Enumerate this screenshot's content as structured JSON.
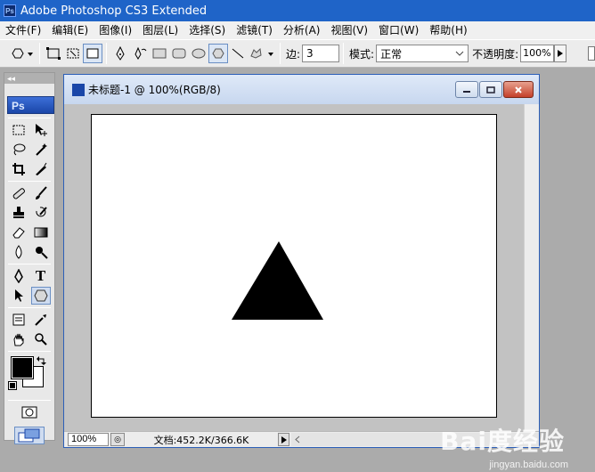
{
  "app": {
    "title": "Adobe Photoshop CS3 Extended",
    "icon_text": "Ps"
  },
  "menubar": {
    "items": [
      {
        "label": "文件(F)"
      },
      {
        "label": "编辑(E)"
      },
      {
        "label": "图像(I)"
      },
      {
        "label": "图层(L)"
      },
      {
        "label": "选择(S)"
      },
      {
        "label": "滤镜(T)"
      },
      {
        "label": "分析(A)"
      },
      {
        "label": "视图(V)"
      },
      {
        "label": "窗口(W)"
      },
      {
        "label": "帮助(H)"
      }
    ]
  },
  "options": {
    "sides_label": "边:",
    "sides_value": "3",
    "mode_label": "模式:",
    "mode_value": "正常",
    "opacity_label": "不透明度:",
    "opacity_value": "100%"
  },
  "toolbox": {
    "logo": "Ps",
    "text_tool": "T"
  },
  "document": {
    "title": "未标题-1 @ 100%(RGB/8)",
    "zoom": "100%",
    "info": "文档:452.2K/366.6K",
    "shape_fill": "#000000",
    "canvas_color": "#ffffff"
  },
  "watermark": {
    "main": "Bai度经验",
    "sub": "jingyan.baidu.com"
  }
}
